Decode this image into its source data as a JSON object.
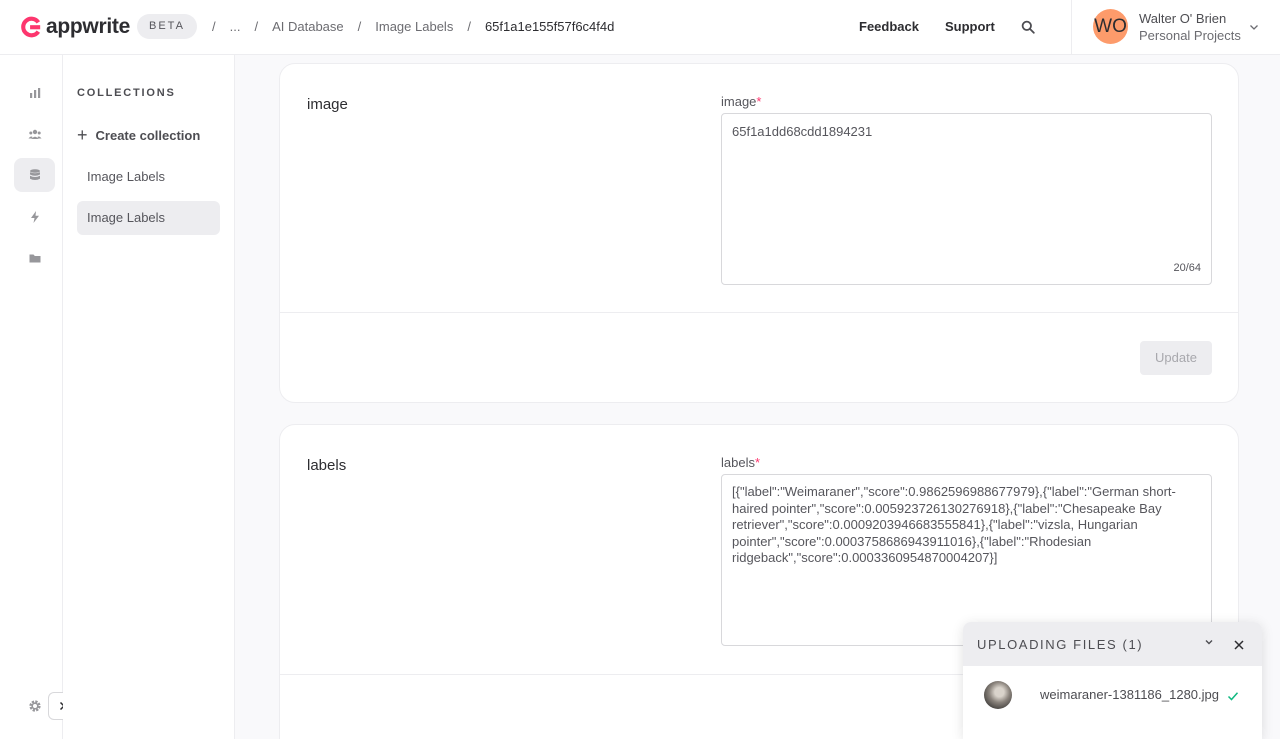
{
  "header": {
    "brand": "appwrite",
    "badge": "BETA",
    "breadcrumbs": [
      "...",
      "AI Database",
      "Image Labels",
      "65f1a1e155f57f6c4f4d"
    ],
    "sep": "/",
    "links": {
      "feedback": "Feedback",
      "support": "Support"
    },
    "user": {
      "initials": "WO",
      "name": "Walter O' Brien",
      "project": "Personal Projects"
    }
  },
  "sidebar": {
    "rail_icons": [
      "chart-icon",
      "users-icon",
      "database-icon",
      "bolt-icon",
      "folder-icon",
      "gear-icon"
    ]
  },
  "subnav": {
    "title": "COLLECTIONS",
    "create_label": "Create collection",
    "items": [
      "Image Labels",
      "Image Labels"
    ]
  },
  "image_card": {
    "title": "image",
    "field_label": "image",
    "value": "65f1a1dd68cdd1894231",
    "counter": "20/64",
    "update_label": "Update"
  },
  "labels_card": {
    "title": "labels",
    "field_label": "labels",
    "value": "[{\"label\":\"Weimaraner\",\"score\":0.9862596988677979},{\"label\":\"German short-haired pointer\",\"score\":0.005923726130276918},{\"label\":\"Chesapeake Bay retriever\",\"score\":0.0009203946683555841},{\"label\":\"vizsla, Hungarian pointer\",\"score\":0.0003758686943911016},{\"label\":\"Rhodesian ridgeback\",\"score\":0.0003360954870004207}]"
  },
  "upload": {
    "title": "UPLOADING FILES (1)",
    "file_name": "weimaraner-1381186_1280.jpg"
  },
  "colors": {
    "accent": "#fd366e",
    "avatar": "#fd9b6b",
    "success": "#10b981"
  }
}
